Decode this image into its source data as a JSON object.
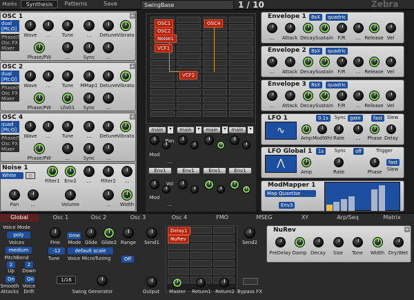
{
  "top": {
    "left_tabs": [
      "Marks",
      "Synthesis",
      "Patterns",
      "Save"
    ],
    "preset_name": "SwingBase",
    "counter": "1 / 10",
    "logo": "Zebra"
  },
  "osc_panels": [
    {
      "title": "OSC 1",
      "side": [
        "dual",
        "[Pit:O]",
        "Phase/Sync",
        "Osc FX",
        "Mixer"
      ],
      "knobs1": [
        "Wave",
        "...",
        "Tune",
        "...",
        "Detune",
        "Vibrato"
      ],
      "knobs2": [
        "Phase/PW",
        "...",
        "Sync",
        "..."
      ]
    },
    {
      "title": "OSC 2",
      "side": [
        "dual",
        "[Pit:O]",
        "Phase/Sync",
        "Osc FX",
        "Mixer"
      ],
      "knobs1": [
        "Wave",
        "...",
        "Tune",
        "MMap1",
        "Detune",
        "Vibrato"
      ],
      "knobs2": [
        "Phase/PW",
        "LfoG1",
        "Sync",
        "..."
      ]
    },
    {
      "title": "OSC 4",
      "side": [
        "quad",
        "[Pit:O]",
        "Phase/Sync",
        "Osc FX",
        "Mixer"
      ],
      "knobs1": [
        "Wave",
        "...",
        "Tune",
        "...",
        "Detune",
        "Vibrato"
      ],
      "knobs2": [
        "Phase/PW",
        "...",
        "Sync",
        "..."
      ]
    }
  ],
  "noise": {
    "title": "Noise 1",
    "type": "White",
    "knobs1": [
      "Filter1",
      "Env2",
      "...",
      "Filter2",
      "..."
    ],
    "knobs2": [
      "Pan",
      "...",
      "Volume",
      "...",
      "Width"
    ]
  },
  "grid": {
    "nodes": [
      "OSC1",
      "OSC2",
      "Noise1",
      "VCF1",
      "OSC4",
      "VCF2"
    ],
    "main_labels": [
      "main",
      "main",
      "main",
      "main"
    ],
    "env_labels": [
      "Env1",
      "Env1",
      "Env1",
      "Env1"
    ],
    "knob_labels": [
      "Pan",
      "Mod",
      "...",
      "Vol",
      "Mod",
      "..."
    ]
  },
  "envelopes": [
    {
      "title": "Envelope 1",
      "mode": "8sX",
      "curve": "quadric",
      "knobs": [
        "...",
        "Attack",
        "Decay",
        "Sustain",
        "F/R",
        "...",
        "Release",
        "Vel"
      ]
    },
    {
      "title": "Envelope 2",
      "mode": "8sX",
      "curve": "quadric",
      "knobs": [
        "...",
        "Attack",
        "Decay",
        "Sustain",
        "F/R",
        "...",
        "Release",
        "Vel"
      ]
    },
    {
      "title": "Envelope 3",
      "mode": "8sX",
      "curve": "quadric",
      "knobs": [
        "...",
        "Attack",
        "Decay",
        "Sustain",
        "F/R",
        "...",
        "Release",
        "Vel"
      ]
    }
  ],
  "lfo1": {
    "title": "LFO 1",
    "rate": "0.1s",
    "sync_label": "Sync",
    "sync": "gate",
    "speed": "fast",
    "slew_label": "Slew",
    "knobs": [
      "Amp",
      "ModWhl",
      "Rate",
      "...",
      "Phase",
      "Delay"
    ]
  },
  "lfog": {
    "title": "LFO Global 1",
    "rate": "1s",
    "sync_label": "Sync",
    "sync": "off",
    "trigger_label": "Trigger",
    "speed": "fast",
    "slew_label": "Slew",
    "knobs": [
      "Amp",
      "Rate",
      "Phase"
    ]
  },
  "modmapper": {
    "title": "ModMapper 1",
    "quantise": "Map Quantise",
    "source": "Env3"
  },
  "tabs": [
    "Global",
    "Osc 1",
    "Osc 2",
    "Osc 3",
    "Osc 4",
    "FMO",
    "MSEG",
    "XY",
    "Arp/Seq",
    "Matrix"
  ],
  "global": {
    "voice_mode_label": "Voice Mode",
    "voice_mode": "poly",
    "voices_label": "Voices",
    "voices": "medium",
    "pitchbend_label": "PitchBend",
    "pb_up": "2",
    "pb_down": "2",
    "up_label": "Up",
    "down_label": "Down",
    "smooth_label": "Smooth",
    "attacks_label": "Attacks",
    "voice_label": "Voice",
    "drift_label": "Drift",
    "on1": "On",
    "on2": "On",
    "fine_label": "Fine",
    "mode_label": "Mode",
    "mode": "time",
    "glide_label": "Glide",
    "glide2_label": "Glide2",
    "range_label": "Range",
    "transpose": "-12",
    "scale": "default scale",
    "tune_label": "Tune",
    "microtuning_label": "Voice MicroTuning",
    "micro_state": "Off",
    "swing": "1/16",
    "swing_label": "Swing Generator",
    "send1": "Send1",
    "send2": "Send2",
    "output": "Output",
    "master": "Master",
    "return1": "Return1",
    "return2": "Return2",
    "bypass": "Bypass FX",
    "fx_nodes": [
      "Delay1",
      "NuRev"
    ]
  },
  "nurev": {
    "title": "NuRev",
    "knobs": [
      "PreDelay",
      "Damp",
      "Decay",
      "Size",
      "Tone",
      "Width",
      "Dry/Wet"
    ]
  }
}
